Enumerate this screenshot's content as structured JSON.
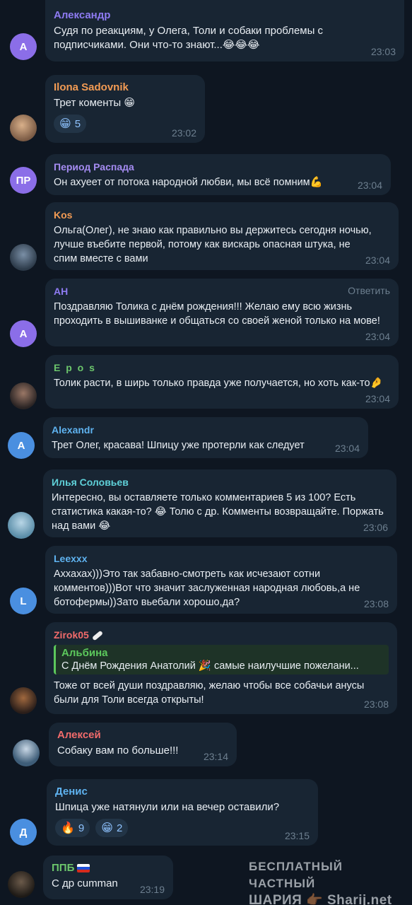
{
  "colors": {
    "background": "#0e1621",
    "bubble": "#182533",
    "text": "#e9eef3",
    "time": "#6d7f8f",
    "reaction_bg": "#223446"
  },
  "messages": [
    {
      "author": "Александр",
      "author_color": "#8e7bf2",
      "avatar_letter": "А",
      "avatar_color": "#8b6ee8",
      "text": "Судя по реакциям, у Олега, Толи и собаки проблемы с подписчиками. Они что-то знают...😂😂😂",
      "time": "23:03"
    },
    {
      "author": "Ilona Sadovnik",
      "author_color": "#f29b54",
      "avatar_icon": "user-photo-icon",
      "text": "Трет коменты 😁",
      "time": "23:02",
      "reactions": [
        {
          "emoji": "😁",
          "count": "5"
        }
      ]
    },
    {
      "author": "Период Распада",
      "author_color": "#a58cf2",
      "avatar_letter": "ПР",
      "avatar_color": "#8b6ee8",
      "text": "Он ахуеет от потока народной любви, мы всё помним💪",
      "time": "23:04"
    },
    {
      "author": "Kos",
      "author_color": "#f29b54",
      "avatar_icon": "user-photo-icon",
      "text": "Ольга(Олег), не знаю как правильно вы держитесь сегодня ночью, лучше въебите первой, потому как вискарь опасная штука, не спим вместе с вами",
      "time": "23:04"
    },
    {
      "author": "АН",
      "author_color": "#8e7bf2",
      "avatar_letter": "А",
      "avatar_color": "#8b6ee8",
      "reply_label": "Ответить",
      "text": "Поздравляю Толика с днём рождения!!! Желаю ему всю жизнь проходить в вышиванке и общаться со своей женой только на мове!",
      "time": "23:04"
    },
    {
      "author": "E p o s",
      "author_color": "#6cc66c",
      "avatar_icon": "user-photo-icon",
      "text": "Толик расти, в ширь только правда уже получается, но хоть как-то🤌",
      "time": "23:04"
    },
    {
      "author": "Alexandr",
      "author_color": "#5fb3f0",
      "avatar_letter": "A",
      "avatar_color": "#4a8fe0",
      "text": "Трет Олег, красава! Шпицу уже протерли как следует",
      "time": "23:04"
    },
    {
      "author": "Илья Соловьев",
      "author_color": "#5fd0d8",
      "avatar_icon": "user-photo-icon",
      "text": "Интересно, вы оставляете только комментариев 5 из 100? Есть статистика какая-то? 😂 Толю с др. Комменты возвращайте. Поржать над вами 😂",
      "time": "23:06"
    },
    {
      "author": "Leexxx",
      "author_color": "#5fb3f0",
      "avatar_letter": "L",
      "avatar_color": "#4a8fe0",
      "text": "Аххахах)))Это так забавно-смотреть как исчезают сотни комментов)))Вот что значит заслуженная народная любовь,а не ботофермы))Зато вьебали хорошо,да?",
      "time": "23:08"
    },
    {
      "author": "Zirok05",
      "author_color": "#f26b6b",
      "avatar_icon": "user-photo-icon",
      "quote_author": "Альбина",
      "quote_text": "С Днём Рождения Анатолий 🎉 самые наилучшие пожелани...",
      "text": "Тоже от всей души поздравляю, желаю чтобы все собачьи анусы были для Толи всегда открыты!",
      "time": "23:08"
    },
    {
      "author": "Алексей",
      "author_color": "#f26b6b",
      "avatar_icon": "user-photo-icon",
      "text": "Собаку вам по больше!!!",
      "time": "23:14"
    },
    {
      "author": "Денис",
      "author_color": "#5fb3f0",
      "avatar_letter": "Д",
      "avatar_color": "#4a8fe0",
      "text": "Шпица уже натянули или на вечер оставили?",
      "time": "23:15",
      "reactions": [
        {
          "emoji": "🔥",
          "count": "9"
        },
        {
          "emoji": "😁",
          "count": "2"
        }
      ]
    },
    {
      "author": "ППБ",
      "author_color": "#6cc66c",
      "avatar_icon": "user-photo-icon",
      "text": "С др cumman",
      "time": "23:19"
    }
  ],
  "watermark": {
    "line1": "БЕСПЛАТНЫЙ ЧАСТНЫЙ",
    "line2": "ШАРИЯ 👉🏾 Sharij.net"
  }
}
